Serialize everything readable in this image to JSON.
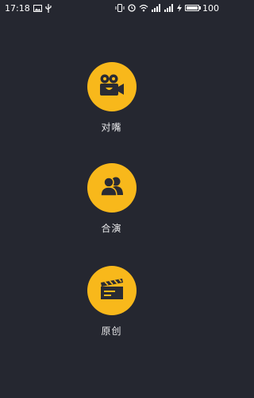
{
  "status_bar": {
    "time": "17:18",
    "battery_level": "100",
    "battery_fraction": 1.0,
    "icons": [
      "image-icon",
      "usb-icon",
      "vibrate-icon",
      "alarm-icon",
      "wifi-icon",
      "signal-icon",
      "signal-icon",
      "charging-icon",
      "battery-icon"
    ]
  },
  "modes": [
    {
      "label": "对嘴",
      "icon": "video-camera-icon"
    },
    {
      "label": "合演",
      "icon": "users-icon"
    },
    {
      "label": "原创",
      "icon": "clapperboard-icon"
    }
  ],
  "colors": {
    "background": "#252730",
    "accent": "#f8b81b",
    "icon_dark": "#2a2b33"
  }
}
